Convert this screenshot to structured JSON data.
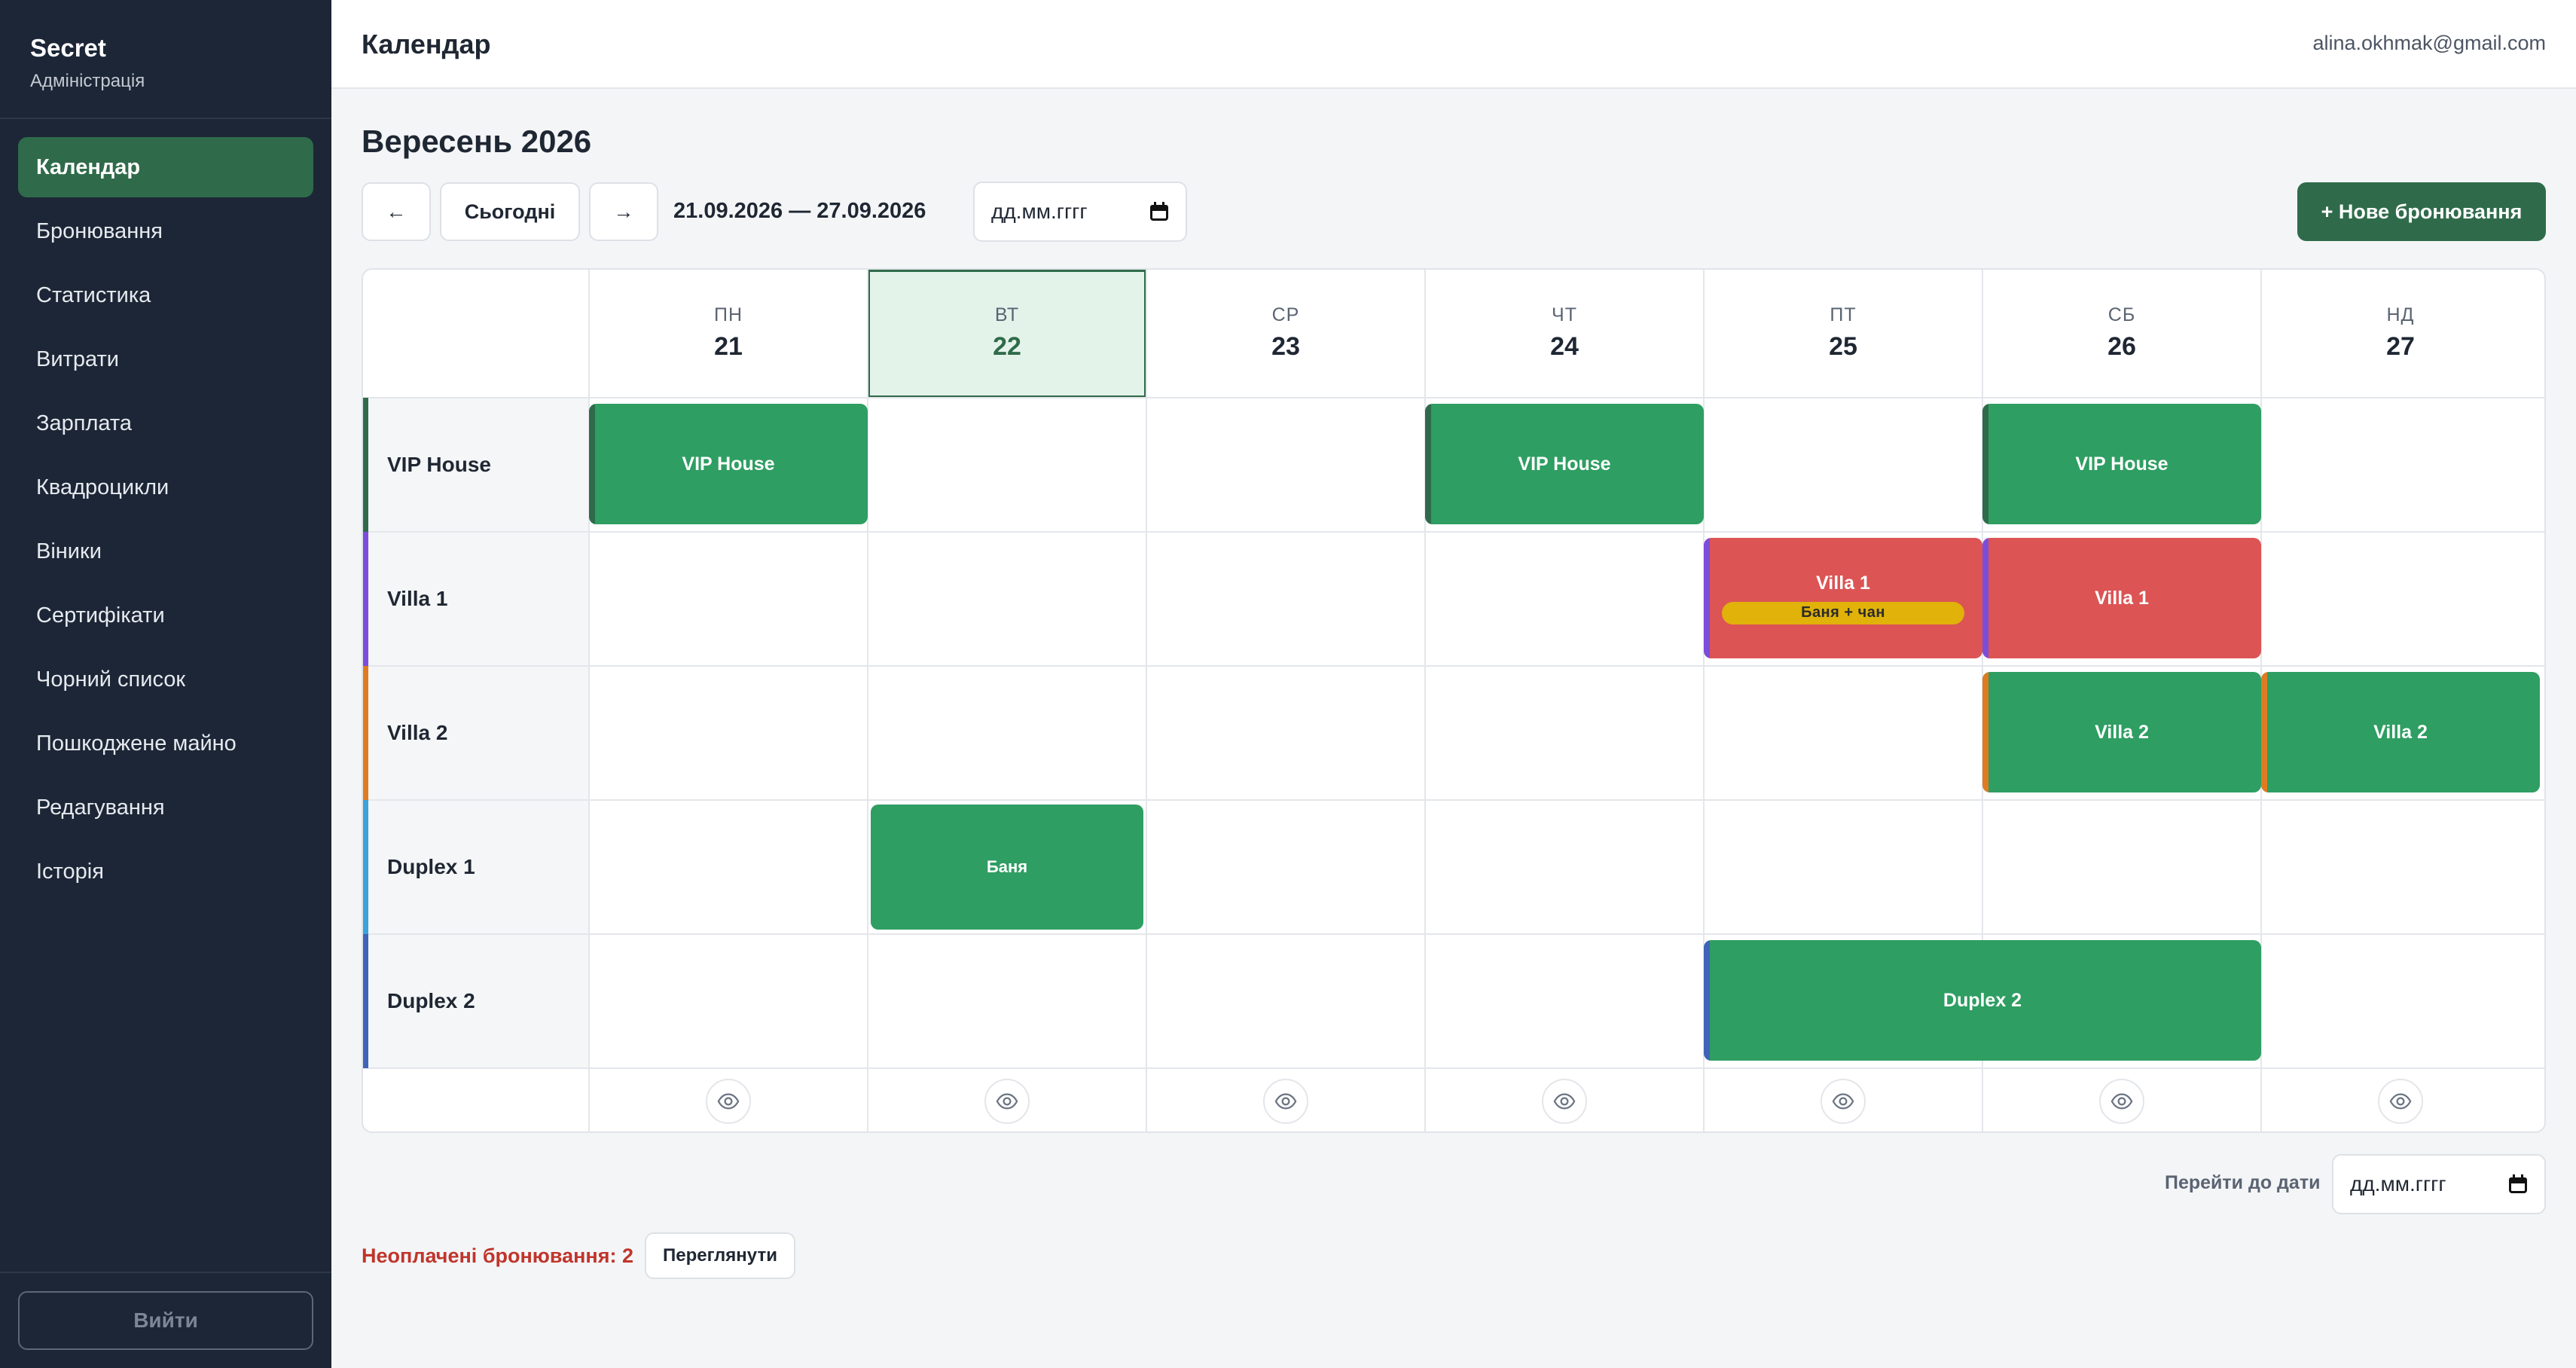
{
  "sidebar": {
    "brand_name": "Secret",
    "brand_sub": "Адміністрація",
    "items": [
      {
        "label": "Календар",
        "active": true
      },
      {
        "label": "Бронювання"
      },
      {
        "label": "Статистика"
      },
      {
        "label": "Витрати"
      },
      {
        "label": "Зарплата"
      },
      {
        "label": "Квадроцикли"
      },
      {
        "label": "Віники"
      },
      {
        "label": "Сертифікати"
      },
      {
        "label": "Чорний список"
      },
      {
        "label": "Пошкоджене майно"
      },
      {
        "label": "Редагування"
      },
      {
        "label": "Історія"
      }
    ],
    "logout_label": "Вийти"
  },
  "header": {
    "title": "Календар",
    "user_email": "alina.okhmak@gmail.com"
  },
  "main": {
    "month_title": "Вересень 2026",
    "prev_label": "←",
    "today_label": "Сьогодні",
    "next_label": "→",
    "range": "21.09.2026 — 27.09.2026",
    "date_placeholder": "дд.мм.гггг",
    "new_booking_label": "+ Нове бронювання"
  },
  "calendar": {
    "days": [
      {
        "dow": "ПН",
        "num": "21"
      },
      {
        "dow": "ВТ",
        "num": "22",
        "today": true
      },
      {
        "dow": "СР",
        "num": "23"
      },
      {
        "dow": "ЧТ",
        "num": "24"
      },
      {
        "dow": "ПТ",
        "num": "25"
      },
      {
        "dow": "СБ",
        "num": "26"
      },
      {
        "dow": "НД",
        "num": "27"
      }
    ],
    "rooms": [
      {
        "name": "VIP House",
        "color": "#2f6b4a"
      },
      {
        "name": "Villa 1",
        "color": "#7c4ddb"
      },
      {
        "name": "Villa 2",
        "color": "#e07b22"
      },
      {
        "name": "Duplex 1",
        "color": "#3aa3d9"
      },
      {
        "name": "Duplex 2",
        "color": "#3f63b8"
      }
    ],
    "bookings": [
      {
        "label": "VIP House",
        "room": 0,
        "day": 0,
        "span": 1,
        "status": "paid"
      },
      {
        "label": "VIP House",
        "room": 0,
        "day": 3,
        "span": 1,
        "status": "paid"
      },
      {
        "label": "VIP House",
        "room": 0,
        "day": 5,
        "span": 1,
        "status": "paid"
      },
      {
        "label": "Villa 1",
        "room": 1,
        "day": 4,
        "span": 1,
        "status": "unpaid",
        "badge": "Баня + чан"
      },
      {
        "label": "Villa 1",
        "room": 1,
        "day": 5,
        "span": 1,
        "status": "unpaid"
      },
      {
        "label": "Villa 2",
        "room": 2,
        "day": 5,
        "span": 1,
        "status": "paid"
      },
      {
        "label": "Villa 2",
        "room": 2,
        "day": 6,
        "span": 1,
        "status": "paid"
      },
      {
        "label": "Баня",
        "room": 3,
        "day": 1,
        "span": 1,
        "status": "paid",
        "service_only": true
      },
      {
        "label": "Duplex 2",
        "room": 4,
        "day": 4,
        "span": 2,
        "status": "paid"
      }
    ],
    "colors": {
      "paid": "#2e9e62",
      "unpaid": "#dc5454",
      "badge": "#e0b20a",
      "accent": "#2f6b4a"
    }
  },
  "footer": {
    "goto_label": "Перейти до дати",
    "date_placeholder": "дд.мм.гггг",
    "unpaid_text": "Неоплачені бронювання: 2",
    "view_label": "Переглянути"
  },
  "icons": {
    "date_picker": "calendar-icon",
    "day_view": "eye-icon"
  }
}
